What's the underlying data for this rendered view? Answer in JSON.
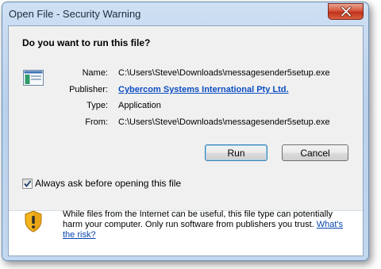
{
  "window": {
    "title": "Open File - Security Warning"
  },
  "dialog": {
    "question": "Do you want to run this file?",
    "fields": {
      "name_label": "Name:",
      "name_value": "C:\\Users\\Steve\\Downloads\\messagesender5setup.exe",
      "publisher_label": "Publisher:",
      "publisher_value": "Cybercom Systems International Pty Ltd.",
      "type_label": "Type:",
      "type_value": "Application",
      "from_label": "From:",
      "from_value": "C:\\Users\\Steve\\Downloads\\messagesender5setup.exe"
    },
    "buttons": {
      "run": "Run",
      "cancel": "Cancel"
    },
    "checkbox": {
      "label": "Always ask before opening this file",
      "checked": true
    },
    "warning": {
      "text": "While files from the Internet can be useful, this file type can potentially harm your computer. Only run software from publishers you trust.",
      "link": "What's the risk?"
    }
  },
  "icons": {
    "close": "close-icon",
    "app": "application-icon",
    "shield": "warning-shield-icon"
  },
  "colors": {
    "link": "#0d4ec2",
    "close_button": "#c8432a"
  }
}
